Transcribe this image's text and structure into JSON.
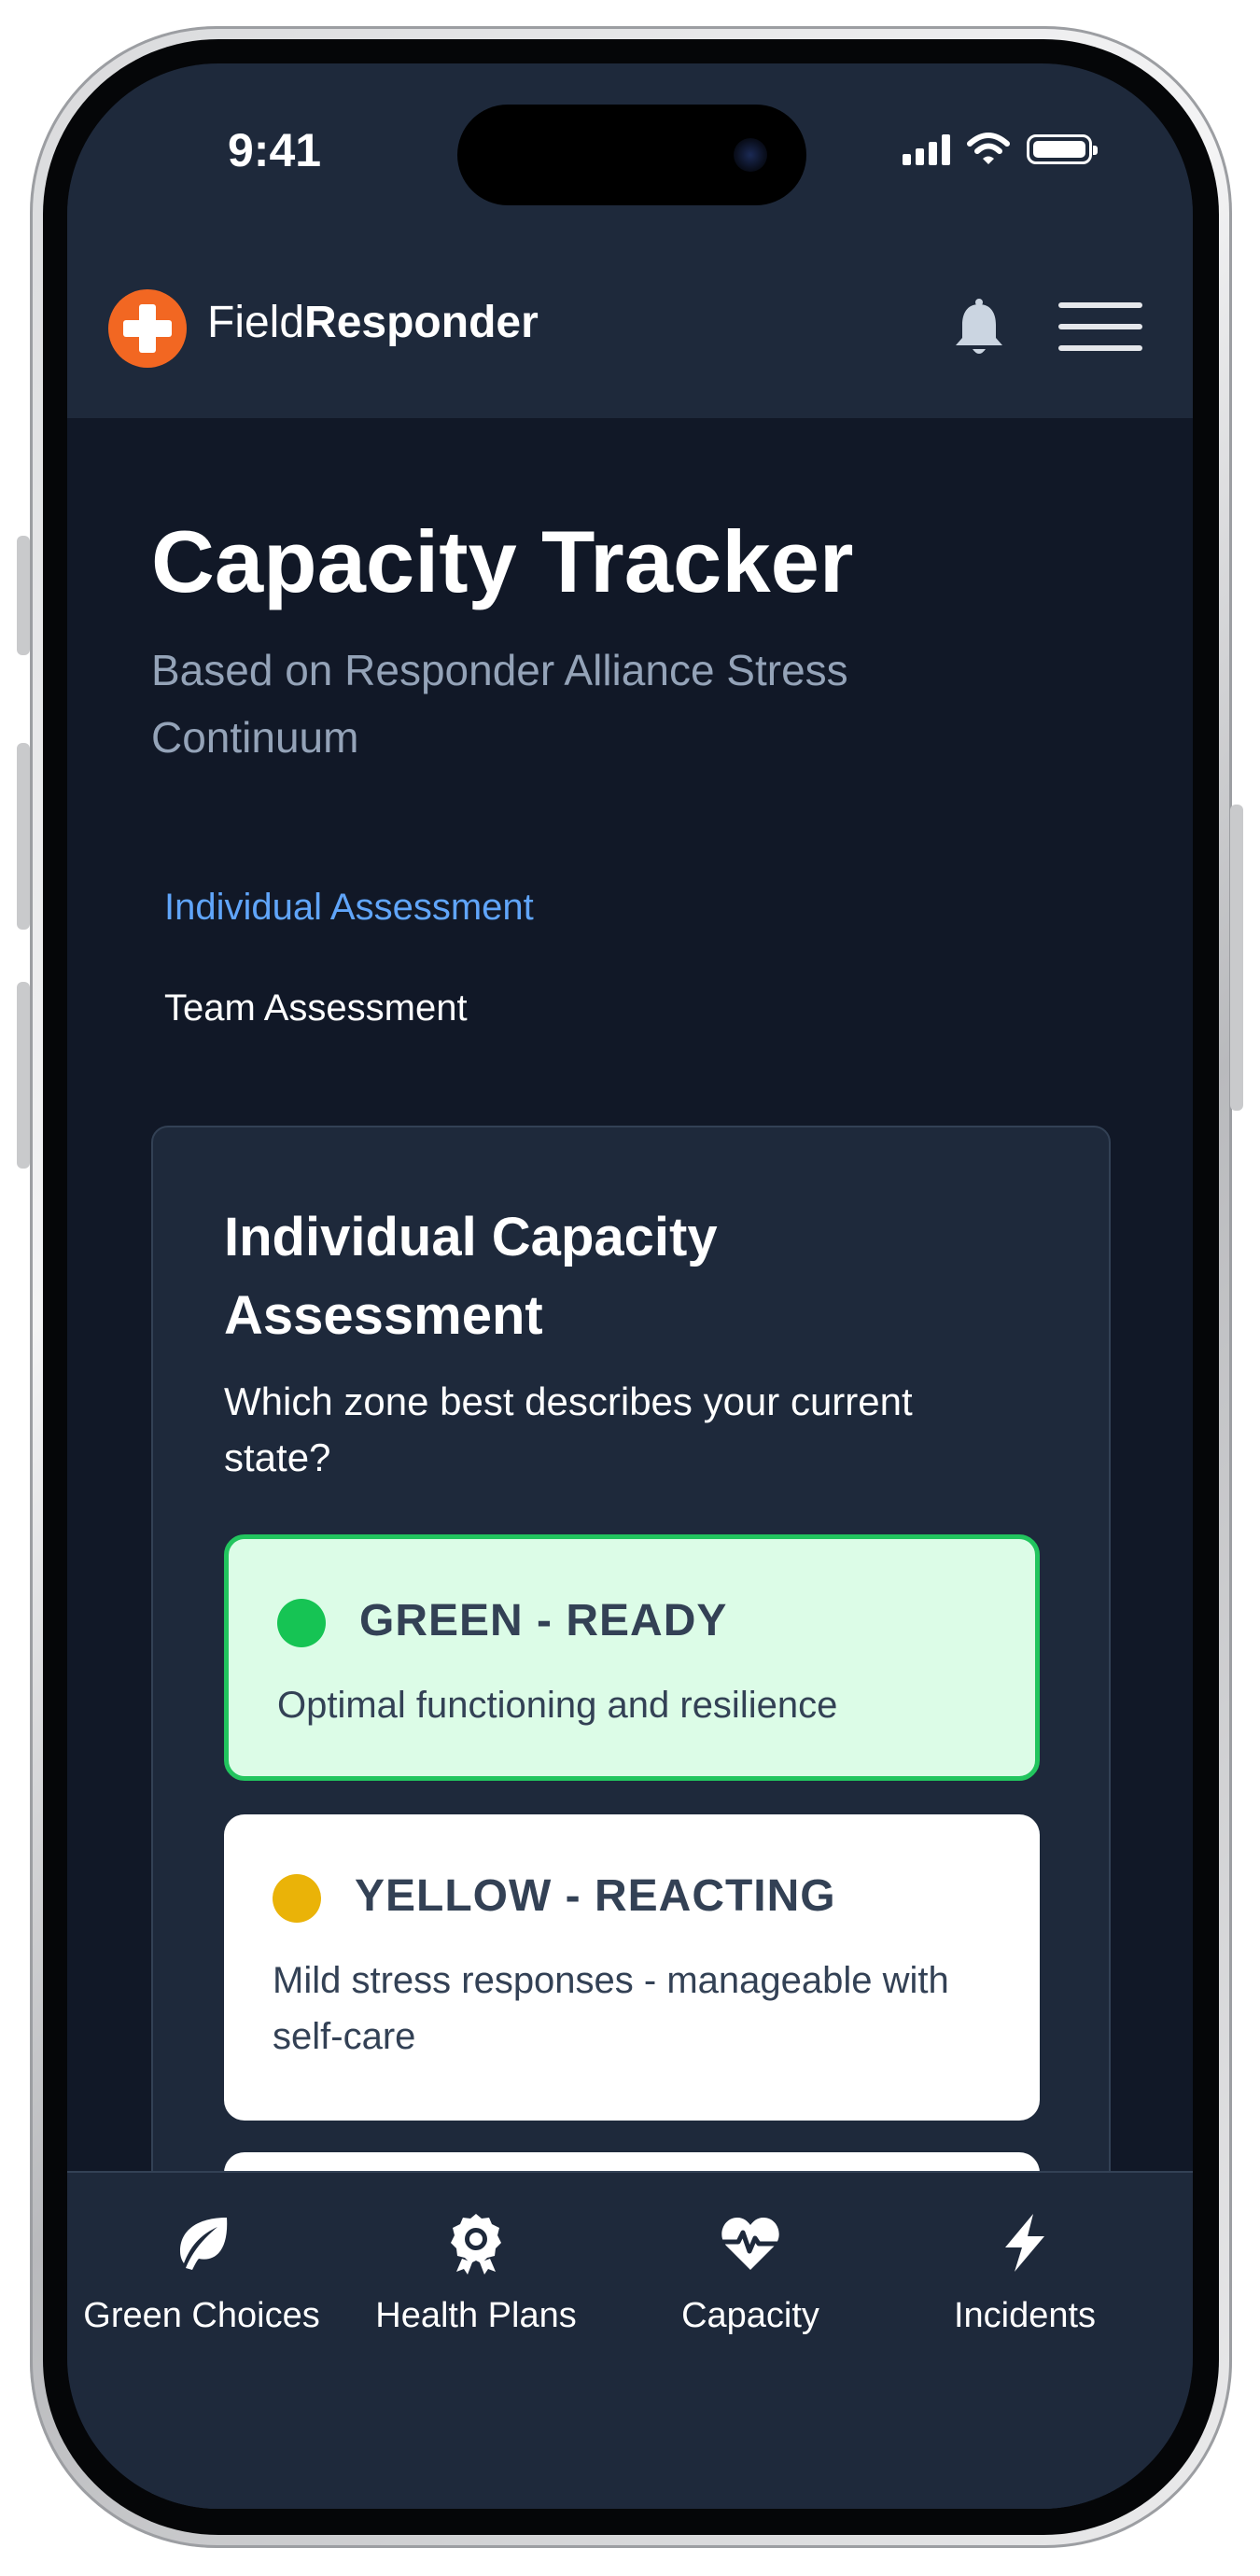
{
  "status_bar": {
    "time": "9:41"
  },
  "header": {
    "brand_light": "Field",
    "brand_bold": "Responder",
    "bell_icon": "bell-icon",
    "menu_icon": "hamburger-menu-icon"
  },
  "page": {
    "title": "Capacity Tracker",
    "subtitle": "Based on Responder Alliance Stress Continuum"
  },
  "tabs": [
    {
      "label": "Individual Assessment",
      "active": true
    },
    {
      "label": "Team Assessment",
      "active": false
    }
  ],
  "assessment": {
    "title": "Individual Capacity Assessment",
    "question": "Which zone best describes your current state?",
    "zones": [
      {
        "name": "GREEN - READY",
        "description": "Optimal functioning and resilience",
        "color": "#16c454",
        "selected": true
      },
      {
        "name": "YELLOW - REACTING",
        "description": "Mild stress responses - manageable with self-care",
        "color": "#eab308",
        "selected": false
      }
    ]
  },
  "bottom_nav": [
    {
      "label": "Green Choices",
      "icon": "leaf-icon"
    },
    {
      "label": "Health Plans",
      "icon": "award-badge-icon"
    },
    {
      "label": "Capacity",
      "icon": "heart-pulse-icon"
    },
    {
      "label": "Incidents",
      "icon": "lightning-bolt-icon"
    }
  ],
  "colors": {
    "background": "#111827",
    "surface": "#1e293b",
    "accent_blue": "#60a5fa",
    "brand_orange": "#f26722"
  }
}
